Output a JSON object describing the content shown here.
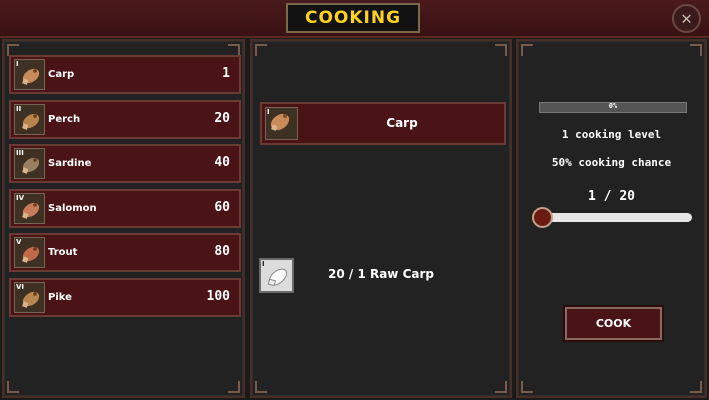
{
  "header": {
    "title": "COOKING",
    "close_symbol": "✕"
  },
  "fish_list": [
    {
      "tier": "I",
      "name": "Carp",
      "level": "1",
      "color": "#c98a5a"
    },
    {
      "tier": "II",
      "name": "Perch",
      "level": "20",
      "color": "#b8844e"
    },
    {
      "tier": "III",
      "name": "Sardine",
      "level": "40",
      "color": "#9a8060"
    },
    {
      "tier": "IV",
      "name": "Salomon",
      "level": "60",
      "color": "#c97a5a"
    },
    {
      "tier": "V",
      "name": "Trout",
      "level": "80",
      "color": "#c06a4a"
    },
    {
      "tier": "VI",
      "name": "Pike",
      "level": "100",
      "color": "#b8864e"
    }
  ],
  "recipe": {
    "selected_tier": "I",
    "selected_name": "Carp",
    "ingredient_tier": "I",
    "ingredient_text": "20 / 1 Raw Carp"
  },
  "stats": {
    "progress_label": "0%",
    "progress_fraction": 0,
    "cooking_level_text": "1 cooking level",
    "cooking_chance_text": "50% cooking chance",
    "quantity_text": "1 / 20",
    "slider_fraction": 0.0
  },
  "actions": {
    "cook_label": "COOK"
  },
  "colors": {
    "accent_yellow": "#ffd21e",
    "row_red": "#4a1416",
    "panel_dark": "#222222"
  }
}
